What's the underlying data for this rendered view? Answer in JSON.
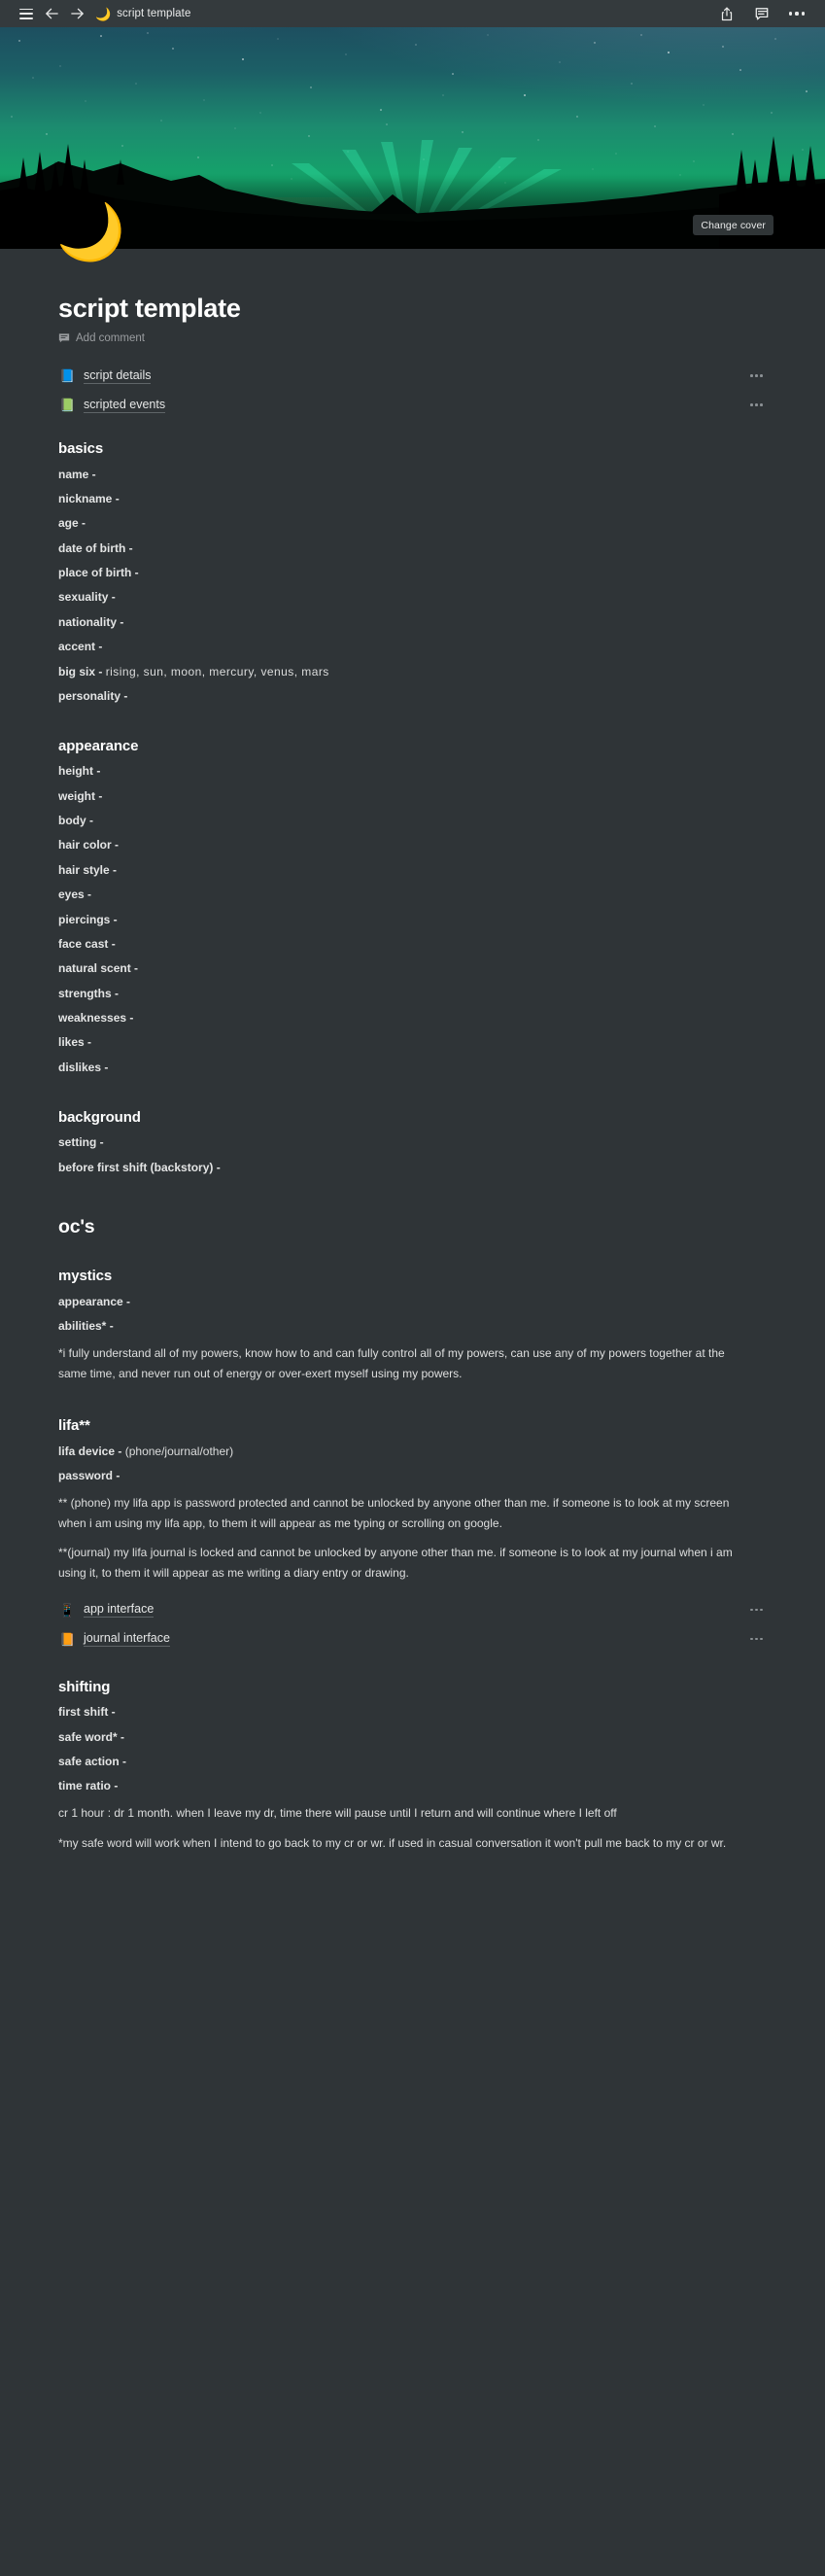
{
  "topbar": {
    "menu_icon": "hamburger-menu-icon",
    "back_icon": "arrow-left-icon",
    "forward_icon": "arrow-right-icon",
    "page_emoji": "🌙",
    "title": "script template",
    "share_icon": "share-icon",
    "comment_icon": "comment-icon",
    "more_icon": "more-options-icon"
  },
  "cover": {
    "change_cover_label": "Change cover",
    "description": "aurora borealis night sky with milky way over silhouetted pine forest and lake"
  },
  "page": {
    "emoji": "🌙",
    "title": "script template",
    "add_comment_label": "Add comment"
  },
  "subpages": [
    {
      "icon": "📘",
      "label": "script details",
      "more": "more-options-icon"
    },
    {
      "icon": "📗",
      "label": "scripted events",
      "more": "more-options-icon"
    }
  ],
  "sections": {
    "basics": {
      "heading": "basics",
      "fields": [
        {
          "label": "name -",
          "value": ""
        },
        {
          "label": "nickname -",
          "value": ""
        },
        {
          "label": "age -",
          "value": ""
        },
        {
          "label": "date of birth -",
          "value": ""
        },
        {
          "label": "place of birth -",
          "value": ""
        },
        {
          "label": "sexuality -",
          "value": ""
        },
        {
          "label": "nationality -",
          "value": ""
        },
        {
          "label": "accent -",
          "value": ""
        },
        {
          "label": "big six -",
          "value": "rising, sun, moon, mercury, venus, mars"
        },
        {
          "label": "personality -",
          "value": ""
        }
      ]
    },
    "appearance": {
      "heading": "appearance",
      "fields": [
        {
          "label": "height -",
          "value": ""
        },
        {
          "label": "weight -",
          "value": ""
        },
        {
          "label": "body -",
          "value": ""
        },
        {
          "label": "hair color -",
          "value": ""
        },
        {
          "label": "hair style -",
          "value": ""
        },
        {
          "label": "eyes -",
          "value": ""
        },
        {
          "label": "piercings -",
          "value": ""
        },
        {
          "label": "face cast -",
          "value": ""
        },
        {
          "label": "natural scent -",
          "value": ""
        },
        {
          "label": "strengths -",
          "value": ""
        },
        {
          "label": "weaknesses -",
          "value": ""
        },
        {
          "label": "likes -",
          "value": ""
        },
        {
          "label": "dislikes -",
          "value": ""
        }
      ]
    },
    "background": {
      "heading": "background",
      "fields": [
        {
          "label": "setting -",
          "value": ""
        },
        {
          "label": "before first shift (backstory) -",
          "value": ""
        }
      ]
    },
    "ocs": {
      "heading": "oc's"
    },
    "mystics": {
      "heading": "mystics",
      "fields": [
        {
          "label": "appearance -",
          "value": ""
        },
        {
          "label": "abilities* -",
          "value": ""
        }
      ],
      "note": "*i fully understand all of my powers, know how to and can fully control all of my powers, can use any of my powers together at the same time, and never run out of energy or over-exert myself using my powers."
    },
    "lifa": {
      "heading": "lifa**",
      "fields": [
        {
          "label": "lifa device -",
          "value": "(phone/journal/other)"
        },
        {
          "label": "password -",
          "value": ""
        }
      ],
      "note_phone": "** (phone) my lifa app is password protected and cannot be unlocked by anyone other than me. if someone is to look at my screen when i am using my lifa app, to them it will appear as me typing or scrolling on google.",
      "note_journal": "**(journal) my lifa journal is locked and cannot be unlocked by anyone other than me. if someone is to look at my journal when i am using it, to them it will appear as me writing a diary entry or drawing.",
      "subpages": [
        {
          "icon": "📱",
          "label": "app interface",
          "more": "more-options-icon"
        },
        {
          "icon": "📙",
          "label": "journal interface",
          "more": "more-options-icon"
        }
      ]
    },
    "shifting": {
      "heading": "shifting",
      "fields": [
        {
          "label": "first shift -",
          "value": ""
        },
        {
          "label": "safe word* -",
          "value": ""
        },
        {
          "label": "safe action -",
          "value": ""
        },
        {
          "label": "time ratio -",
          "value": ""
        }
      ],
      "note_ratio": "cr 1 hour : dr 1 month. when I leave my dr, time there will pause until I return and will continue where I left off",
      "note_safeword": "*my safe word will work when I intend to go back to my cr or wr. if used in casual conversation it won't pull me back to my cr or wr."
    }
  },
  "colors": {
    "background": "#2f3437",
    "topbar": "#343a3d",
    "text": "#e4e5e5",
    "muted": "#9a9da0",
    "moon": "#f2c94c"
  }
}
